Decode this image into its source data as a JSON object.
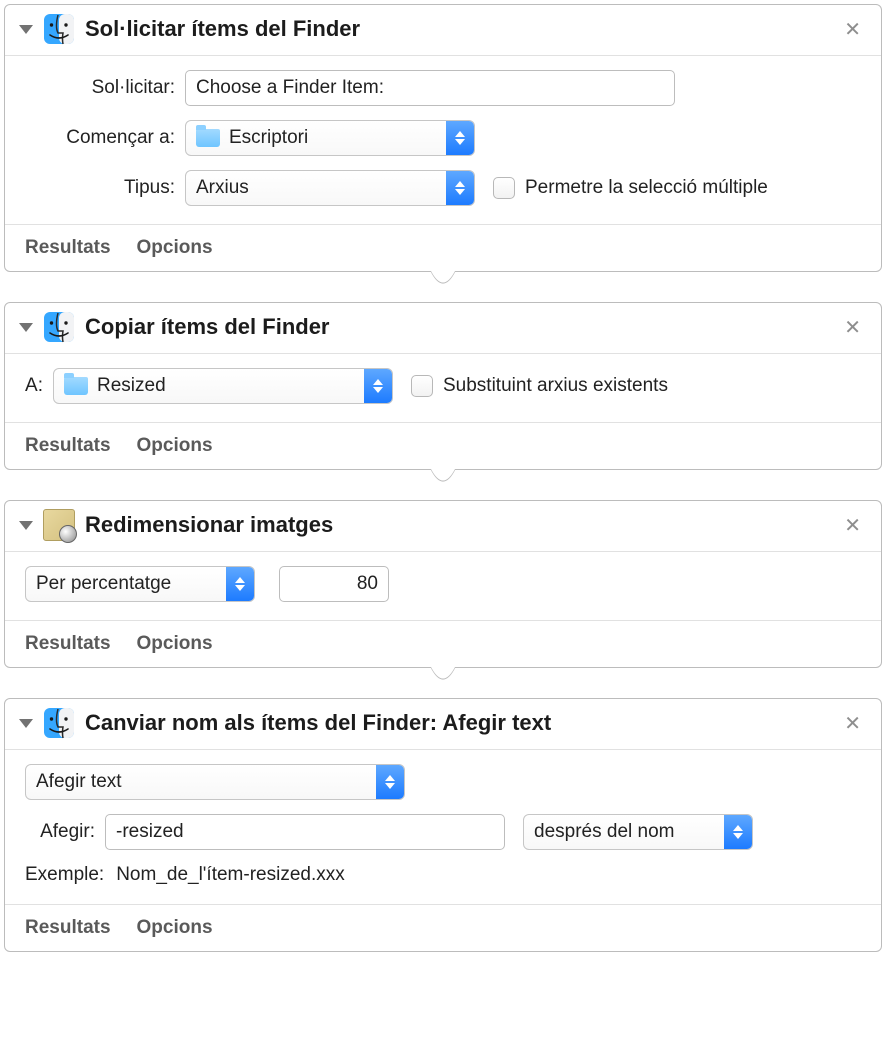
{
  "actions": {
    "a1": {
      "title": "Sol·licitar ítems del Finder",
      "labels": {
        "prompt": "Sol·licitar:",
        "start": "Començar a:",
        "type": "Tipus:"
      },
      "prompt_value": "Choose a Finder Item:",
      "start_folder": "Escriptori",
      "type_value": "Arxius",
      "allow_multiple_label": "Permetre la selecció múltiple"
    },
    "a2": {
      "title": "Copiar ítems del Finder",
      "labels": {
        "to": "A:"
      },
      "to_folder": "Resized",
      "replace_label": "Substituint arxius existents"
    },
    "a3": {
      "title": "Redimensionar imatges",
      "mode": "Per percentatge",
      "value": "80"
    },
    "a4": {
      "title": "Canviar nom als ítems del Finder: Afegir text",
      "mode": "Afegir text",
      "labels": {
        "add": "Afegir:",
        "example": "Exemple:"
      },
      "add_value": "-resized",
      "position": "després del nom",
      "example_value": "Nom_de_l'ítem-resized.xxx"
    }
  },
  "footer": {
    "results": "Resultats",
    "options": "Opcions"
  }
}
